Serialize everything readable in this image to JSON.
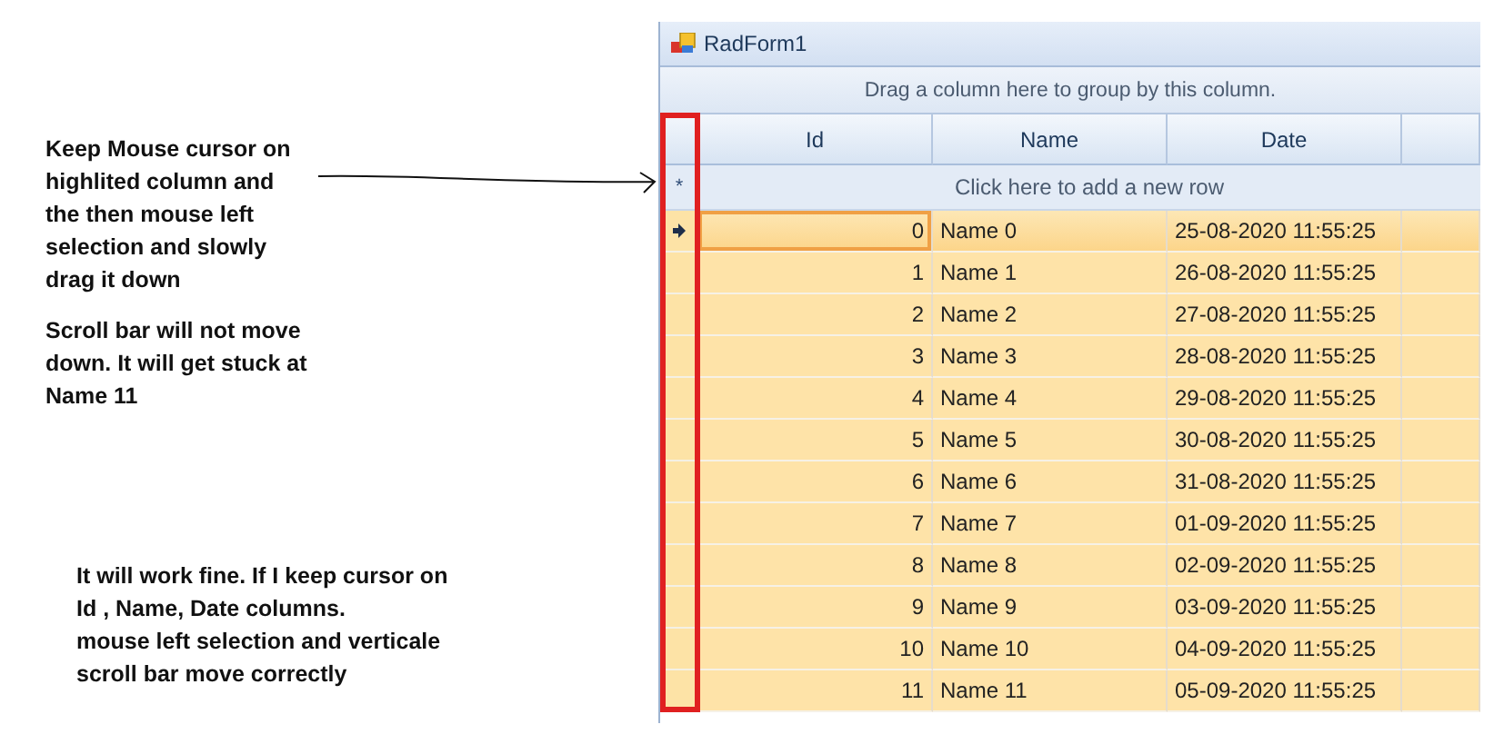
{
  "annotations": [
    {
      "text": "Keep Mouse cursor on\nhighlited column and\nthe then mouse  left\nselection and slowly\ndrag it down"
    },
    {
      "text": "Scroll bar will not move\ndown. It will get stuck at\nName 11"
    },
    {
      "text": "It will work fine. If I keep cursor on\nId , Name, Date columns.\nmouse left selection and verticale\nscroll bar move correctly"
    }
  ],
  "window": {
    "title": "RadForm1"
  },
  "grid": {
    "group_panel": "Drag a column here to group by this column.",
    "columns": [
      "Id",
      "Name",
      "Date"
    ],
    "new_row": {
      "marker": "*",
      "text": "Click here to add a new row"
    },
    "rows": [
      {
        "id": "0",
        "name": "Name 0",
        "date": "25-08-2020 11:55:25",
        "current": true,
        "selected": true
      },
      {
        "id": "1",
        "name": "Name 1",
        "date": "26-08-2020 11:55:25",
        "current": false,
        "selected": true
      },
      {
        "id": "2",
        "name": "Name 2",
        "date": "27-08-2020 11:55:25",
        "current": false,
        "selected": true
      },
      {
        "id": "3",
        "name": "Name 3",
        "date": "28-08-2020 11:55:25",
        "current": false,
        "selected": true
      },
      {
        "id": "4",
        "name": "Name 4",
        "date": "29-08-2020 11:55:25",
        "current": false,
        "selected": true
      },
      {
        "id": "5",
        "name": "Name 5",
        "date": "30-08-2020 11:55:25",
        "current": false,
        "selected": true
      },
      {
        "id": "6",
        "name": "Name 6",
        "date": "31-08-2020 11:55:25",
        "current": false,
        "selected": true
      },
      {
        "id": "7",
        "name": "Name 7",
        "date": "01-09-2020 11:55:25",
        "current": false,
        "selected": true
      },
      {
        "id": "8",
        "name": "Name 8",
        "date": "02-09-2020 11:55:25",
        "current": false,
        "selected": true
      },
      {
        "id": "9",
        "name": "Name 9",
        "date": "03-09-2020 11:55:25",
        "current": false,
        "selected": true
      },
      {
        "id": "10",
        "name": "Name 10",
        "date": "04-09-2020 11:55:25",
        "current": false,
        "selected": true
      },
      {
        "id": "11",
        "name": "Name 11",
        "date": "05-09-2020 11:55:25",
        "current": false,
        "selected": true
      }
    ]
  }
}
